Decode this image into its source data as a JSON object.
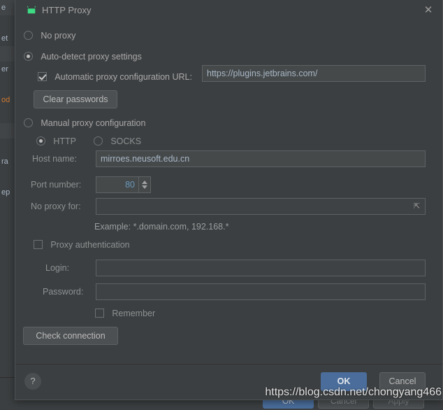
{
  "background": {
    "tree_rows": [
      {
        "text": "e",
        "style": "alt"
      },
      {
        "text": "",
        "style": ""
      },
      {
        "text": "et",
        "style": ""
      },
      {
        "text": "",
        "style": "alt"
      },
      {
        "text": "er",
        "style": ""
      },
      {
        "text": "",
        "style": ""
      },
      {
        "text": "od",
        "style": "hl"
      },
      {
        "text": "",
        "style": ""
      },
      {
        "text": "",
        "style": "alt"
      },
      {
        "text": "",
        "style": ""
      },
      {
        "text": "ra",
        "style": ""
      },
      {
        "text": "",
        "style": ""
      },
      {
        "text": "ep",
        "style": ""
      }
    ],
    "buttons": {
      "ok": "OK",
      "cancel": "Cancel",
      "apply": "Apply"
    }
  },
  "dialog": {
    "title": "HTTP Proxy",
    "icon": "android-icon",
    "close_icon": "close-icon",
    "proxy_mode": {
      "no_proxy": {
        "label": "No proxy",
        "selected": false
      },
      "auto_detect": {
        "label": "Auto-detect proxy settings",
        "selected": true
      },
      "manual": {
        "label": "Manual proxy configuration",
        "selected": false
      }
    },
    "auto_pac": {
      "label": "Automatic proxy configuration URL:",
      "checked": true,
      "url_value": "https://plugins.jetbrains.com/",
      "url_placeholder": ""
    },
    "clear_passwords_label": "Clear passwords",
    "protocol": {
      "http": {
        "label": "HTTP",
        "selected": true
      },
      "socks": {
        "label": "SOCKS",
        "selected": false
      }
    },
    "fields": {
      "host_name": {
        "label": "Host name:",
        "value": "mirroes.neusoft.edu.cn",
        "placeholder": ""
      },
      "port_number": {
        "label": "Port number:",
        "value": "80"
      },
      "no_proxy_for": {
        "label": "No proxy for:",
        "value": "",
        "placeholder": "",
        "expand_icon": "expand-icon"
      },
      "example_hint": "Example: *.domain.com, 192.168.*",
      "login": {
        "label": "Login:",
        "value": "",
        "placeholder": ""
      },
      "password": {
        "label": "Password:",
        "value": "",
        "placeholder": ""
      }
    },
    "proxy_auth": {
      "label": "Proxy authentication",
      "checked": false
    },
    "remember": {
      "label": "Remember",
      "checked": false
    },
    "check_connection_label": "Check connection",
    "footer": {
      "help_label": "?",
      "ok_label": "OK",
      "cancel_label": "Cancel"
    }
  },
  "watermark": {
    "text": "https://blog.csdn.net/chongyang466"
  },
  "colors": {
    "accent": "#4a6d9b",
    "window_bg": "#3c3f41",
    "field_bg": "#45494a",
    "field_text": "#a9b7c6",
    "android_green": "#3ddc84"
  }
}
